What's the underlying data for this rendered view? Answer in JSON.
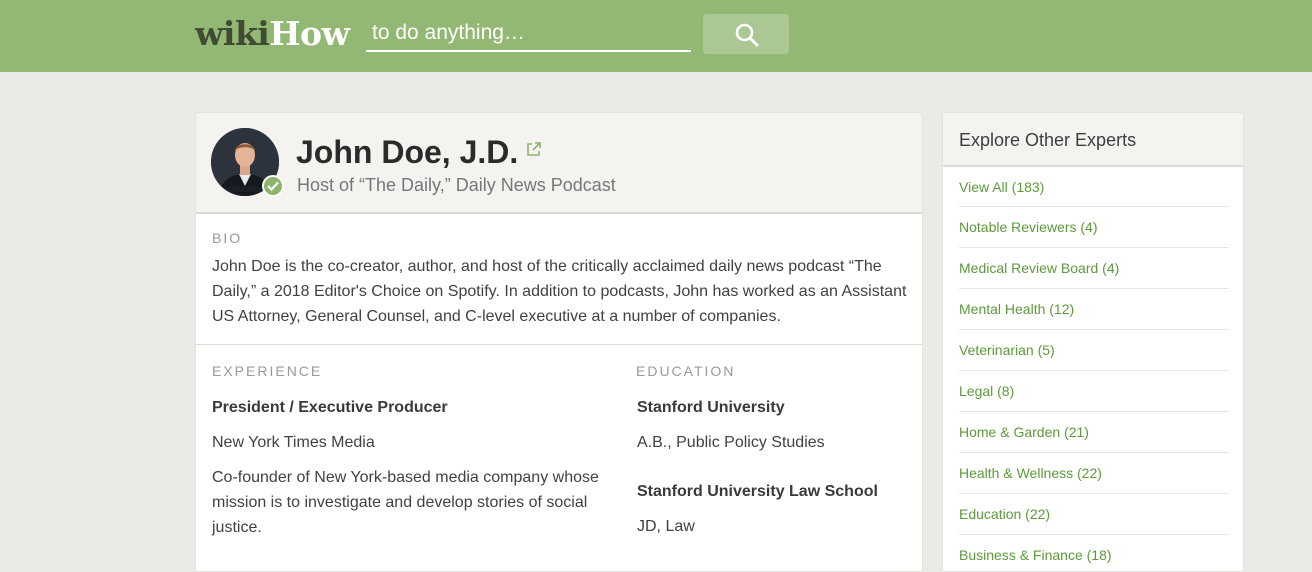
{
  "header": {
    "logo_wiki": "wiki",
    "logo_how": "How",
    "search_placeholder": "to do anything…"
  },
  "profile": {
    "name": "John Doe, J.D.",
    "subtitle": "Host of “The Daily,” Daily News Podcast"
  },
  "bio": {
    "label": "BIO",
    "text": "John Doe is the co-creator, author, and host of the critically acclaimed daily news podcast “The Daily,” a 2018 Editor's Choice on Spotify. In addition to podcasts, John has worked as an Assistant US Attorney, General Counsel, and C-level executive at a number of companies."
  },
  "experience": {
    "label": "EXPERIENCE",
    "title": "President / Executive Producer",
    "company": "New York Times Media",
    "description": "Co-founder of New York-based media company whose mission is to investigate and develop stories of social justice."
  },
  "education": {
    "label": "EDUCATION",
    "items": [
      {
        "school": "Stanford University",
        "degree": "A.B., Public Policy Studies"
      },
      {
        "school": "Stanford University Law School",
        "degree": "JD, Law"
      }
    ]
  },
  "sidebar": {
    "title": "Explore Other Experts",
    "items": [
      {
        "label": "View All (183)"
      },
      {
        "label": "Notable Reviewers (4)"
      },
      {
        "label": "Medical Review Board (4)"
      },
      {
        "label": "Mental Health (12)"
      },
      {
        "label": "Veterinarian (5)"
      },
      {
        "label": "Legal (8)"
      },
      {
        "label": "Home & Garden (21)"
      },
      {
        "label": "Health & Wellness (22)"
      },
      {
        "label": "Education (22)"
      },
      {
        "label": "Business & Finance (18)"
      }
    ]
  },
  "colors": {
    "header_bg": "#93b874",
    "link_green": "#5d9a3b",
    "page_bg": "#ebeae5"
  },
  "icons": {
    "search": "search-icon",
    "external": "external-link-icon",
    "verified": "verified-check-icon"
  }
}
